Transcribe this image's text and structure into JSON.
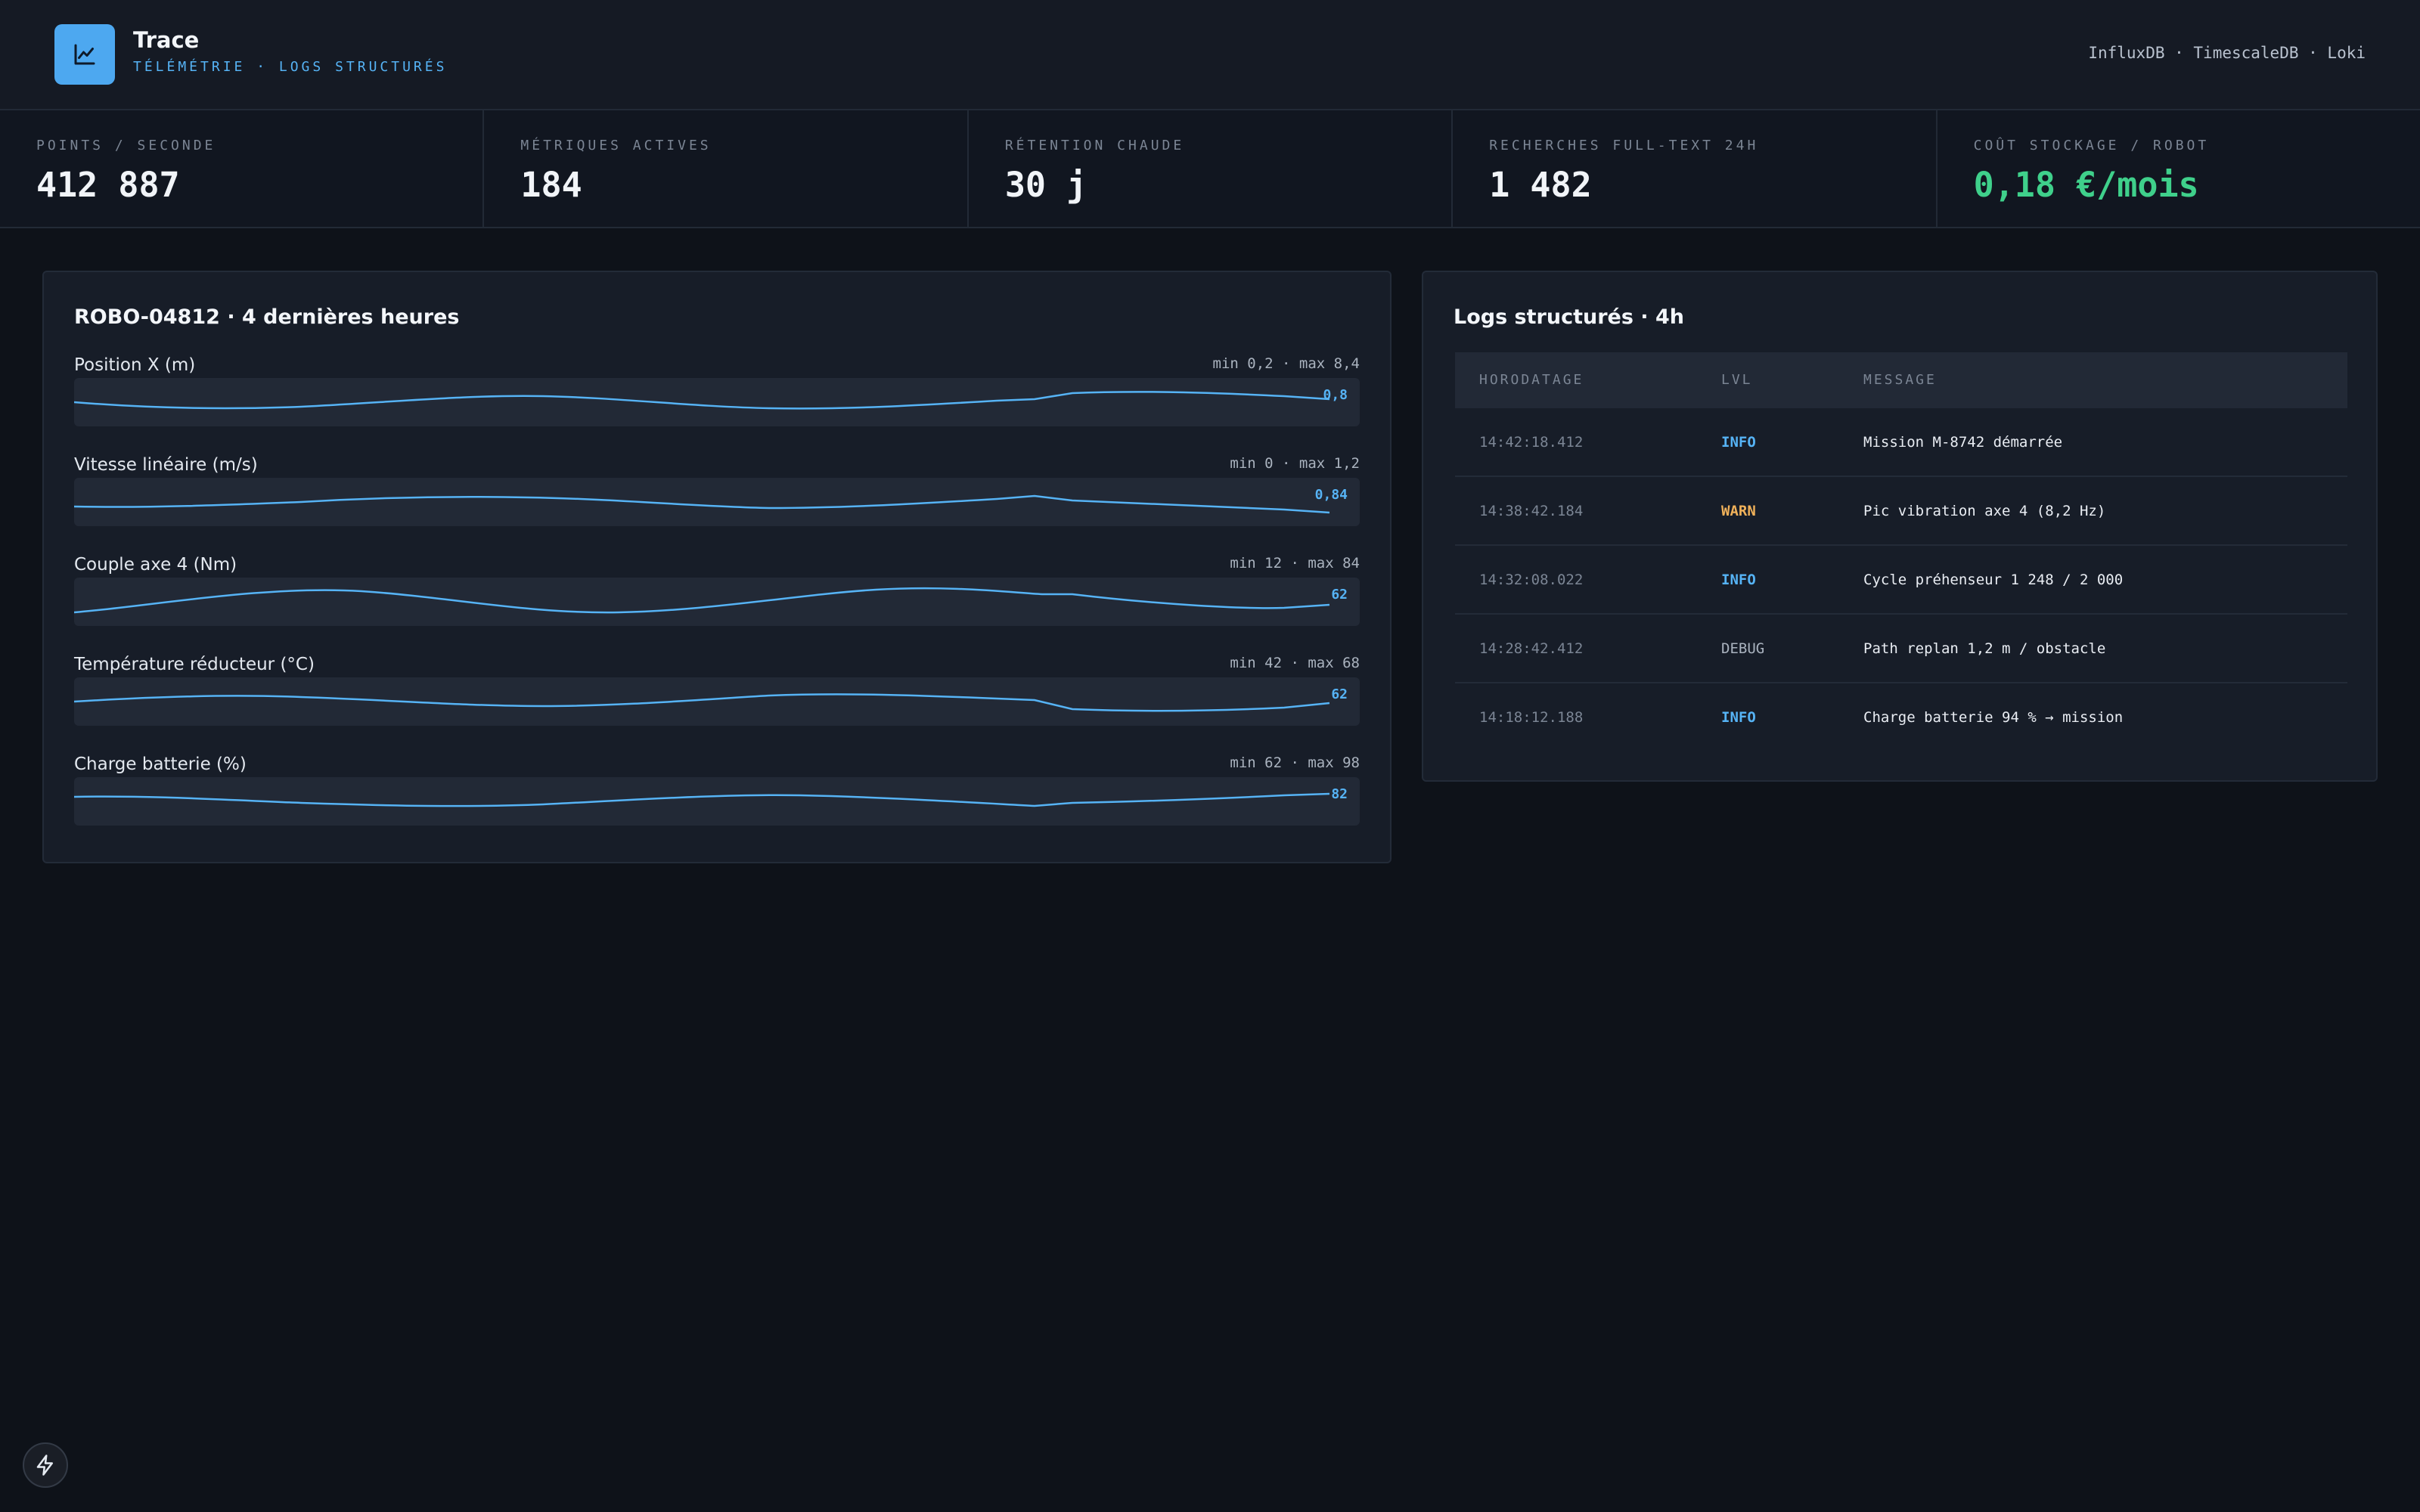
{
  "header": {
    "title": "Trace",
    "subtitle": "TÉLÉMÉTRIE · LOGS STRUCTURÉS",
    "sources": "InfluxDB · TimescaleDB · Loki",
    "logo_icon": "line-chart-icon"
  },
  "stats": [
    {
      "label": "POINTS / SECONDE",
      "value": "412 887",
      "color": "#f1f4f8"
    },
    {
      "label": "MÉTRIQUES ACTIVES",
      "value": "184",
      "color": "#f1f4f8"
    },
    {
      "label": "RÉTENTION CHAUDE",
      "value": "30 j",
      "color": "#f1f4f8"
    },
    {
      "label": "RECHERCHES FULL-TEXT 24H",
      "value": "1 482",
      "color": "#f1f4f8"
    },
    {
      "label": "COÛT STOCKAGE / ROBOT",
      "value": "0,18 €/mois",
      "color": "#3fd08b"
    }
  ],
  "metrics_panel": {
    "title": "ROBO-04812 · 4 dernières heures",
    "metrics": [
      {
        "name": "Position X (m)",
        "range": "min 0,2 · max 8,4",
        "current": "0,8"
      },
      {
        "name": "Vitesse linéaire (m/s)",
        "range": "min 0 · max 1,2",
        "current": "0,84"
      },
      {
        "name": "Couple axe 4 (Nm)",
        "range": "min 12 · max 84",
        "current": "62"
      },
      {
        "name": "Température réducteur (°C)",
        "range": "min 42 · max 68",
        "current": "62"
      },
      {
        "name": "Charge batterie (%)",
        "range": "min 62 · max 98",
        "current": "82"
      }
    ]
  },
  "logs_panel": {
    "title": "Logs structurés · 4h",
    "columns": [
      "HORODATAGE",
      "LVL",
      "MESSAGE"
    ],
    "rows": [
      {
        "time": "14:42:18.412",
        "level": "INFO",
        "message": "Mission M-8742 démarrée"
      },
      {
        "time": "14:38:42.184",
        "level": "WARN",
        "message": "Pic vibration axe 4 (8,2 Hz)"
      },
      {
        "time": "14:32:08.022",
        "level": "INFO",
        "message": "Cycle préhenseur 1 248 / 2 000"
      },
      {
        "time": "14:28:42.412",
        "level": "DEBUG",
        "message": "Path replan 1,2 m / obstacle"
      },
      {
        "time": "14:18:12.188",
        "level": "INFO",
        "message": "Charge batterie 94 % → mission"
      }
    ]
  },
  "colors": {
    "accent": "#56b3f5",
    "positive": "#3fd08b",
    "warn": "#f0b15a"
  },
  "floating_button_icon": "lightning-bolt-icon"
}
